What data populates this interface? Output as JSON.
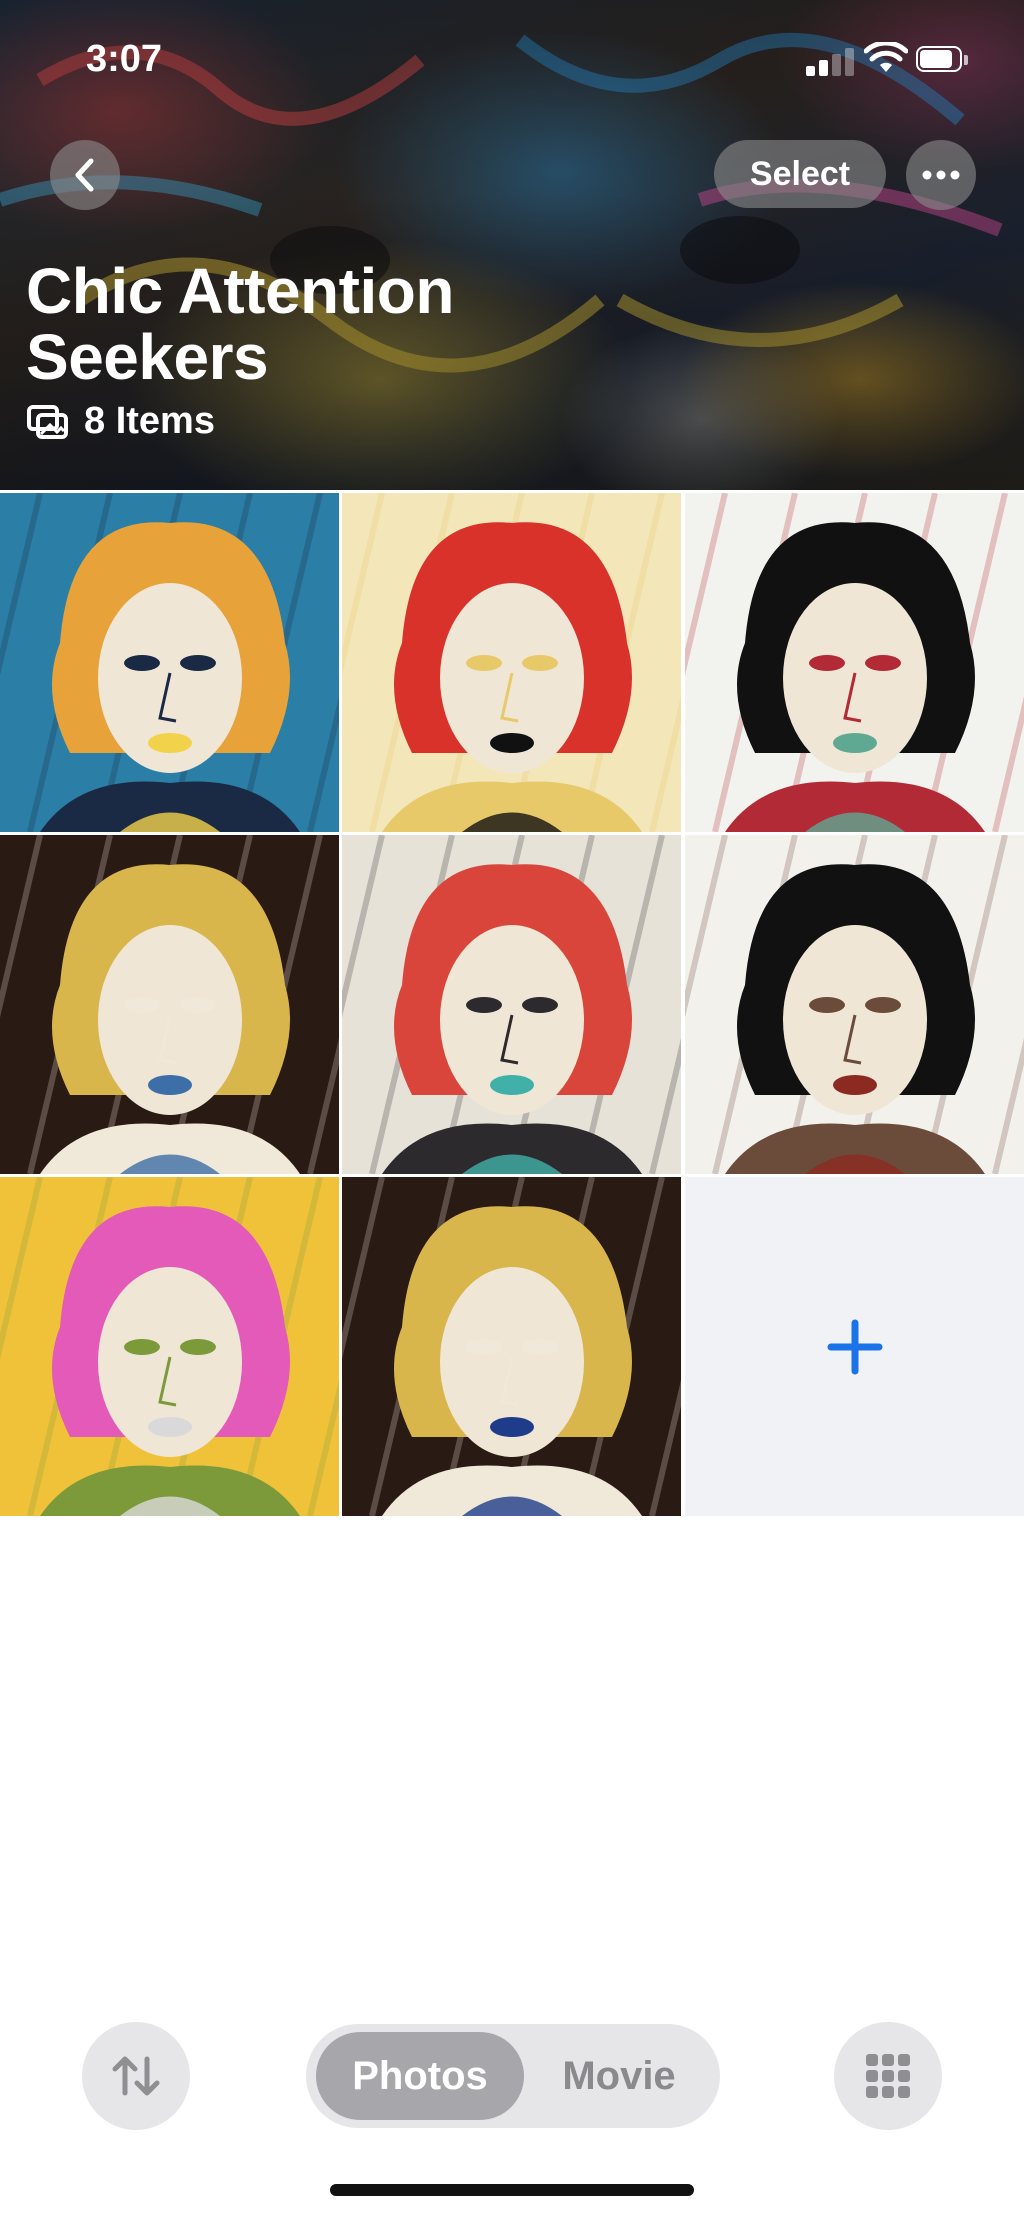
{
  "status_bar": {
    "time": "3:07",
    "signal_bars_active": 2,
    "battery_fraction": 0.85
  },
  "header": {
    "select_label": "Select",
    "album_title": "Chic Attention Seekers",
    "items_count": "8 Items"
  },
  "grid": {
    "photos": [
      {
        "name": "photo-1",
        "palette": [
          "#2b7ea6",
          "#e7a23a",
          "#f2d24b",
          "#1b2a44"
        ]
      },
      {
        "name": "photo-2",
        "palette": [
          "#f3e6b8",
          "#d8322a",
          "#111111",
          "#e7c96a"
        ]
      },
      {
        "name": "photo-3",
        "palette": [
          "#f2f2ee",
          "#111111",
          "#5fa892",
          "#b32a37"
        ]
      },
      {
        "name": "photo-4",
        "palette": [
          "#2a1a14",
          "#d9b64c",
          "#3d6ea8",
          "#f0e8d8"
        ]
      },
      {
        "name": "photo-5",
        "palette": [
          "#e7e2d8",
          "#d9453a",
          "#40b0a8",
          "#2d2a2e"
        ]
      },
      {
        "name": "photo-6",
        "palette": [
          "#f3f1ec",
          "#111111",
          "#8c2a22",
          "#6b4c3b"
        ]
      },
      {
        "name": "photo-7",
        "palette": [
          "#f0c23a",
          "#e45ab9",
          "#d9d9d9",
          "#7c9a3a"
        ]
      },
      {
        "name": "photo-8",
        "palette": [
          "#2a1a14",
          "#d9b64c",
          "#1f3c8a",
          "#f0e8d8"
        ]
      }
    ],
    "add_icon": "plus-icon",
    "accent_color": "#1a73e8"
  },
  "toolbar": {
    "sort_icon": "sort-arrows-icon",
    "segments": [
      "Photos",
      "Movie"
    ],
    "selected_segment": "Photos",
    "grid_icon": "grid-icon"
  }
}
